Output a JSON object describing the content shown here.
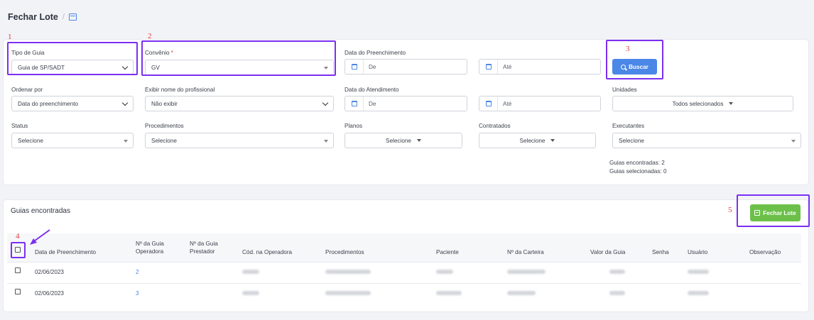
{
  "header": {
    "title": "Fechar Lote",
    "separator": "/"
  },
  "filters": {
    "tipo_guia": {
      "label": "Tipo de Guia",
      "value": "Guia de SP/SADT"
    },
    "convenio": {
      "label": "Convênio",
      "required_mark": "*",
      "value": "GV"
    },
    "data_preenchimento": {
      "label": "Data do Preenchimento",
      "from_placeholder": "De",
      "to_placeholder": "Até"
    },
    "buscar_label": "Buscar",
    "ordenar": {
      "label": "Ordenar por",
      "value": "Data do preenchimento"
    },
    "exibir_nome": {
      "label": "Exibir nome do profissional",
      "value": "Não exibir"
    },
    "data_atendimento": {
      "label": "Data do Atendimento",
      "from_placeholder": "De",
      "to_placeholder": "Até"
    },
    "unidades": {
      "label": "Unidades",
      "value": "Todos selecionados"
    },
    "status": {
      "label": "Status",
      "value": "Selecione"
    },
    "procedimentos": {
      "label": "Procedimentos",
      "value": "Selecione"
    },
    "planos": {
      "label": "Planos",
      "value": "Selecione"
    },
    "contratados": {
      "label": "Contratados",
      "value": "Selecione"
    },
    "executantes": {
      "label": "Executantes",
      "value": "Selecione"
    },
    "guias_encontradas": "Guias encontradas: 2",
    "guias_selecionadas": "Guias selecionadas: 0"
  },
  "results": {
    "title": "Guias encontradas",
    "fechar_label": "Fechar Lote",
    "columns": {
      "data": "Data de Preenchimento",
      "guia_operadora_1": "Nº da Guia",
      "guia_operadora_2": "Operadora",
      "guia_prestador_1": "Nº da Guia",
      "guia_prestador_2": "Prestador",
      "cod_operadora": "Cód. na Operadora",
      "procedimentos": "Procedimentos",
      "paciente": "Paciente",
      "carteira": "Nº da Carteira",
      "valor": "Valor da Guia",
      "senha": "Senha",
      "usuario": "Usuário",
      "observacao": "Observação"
    },
    "rows": [
      {
        "data": "02/06/2023",
        "guia_operadora": "2"
      },
      {
        "data": "02/06/2023",
        "guia_operadora": "3"
      }
    ]
  },
  "annotations": {
    "n1": "1",
    "n2": "2",
    "n3": "3",
    "n4": "4",
    "n5": "5"
  },
  "colors": {
    "accent_blue": "#4b87e6",
    "green": "#6cc04a",
    "annotation_purple": "#7b2ff2",
    "annotation_red": "#e53935"
  }
}
